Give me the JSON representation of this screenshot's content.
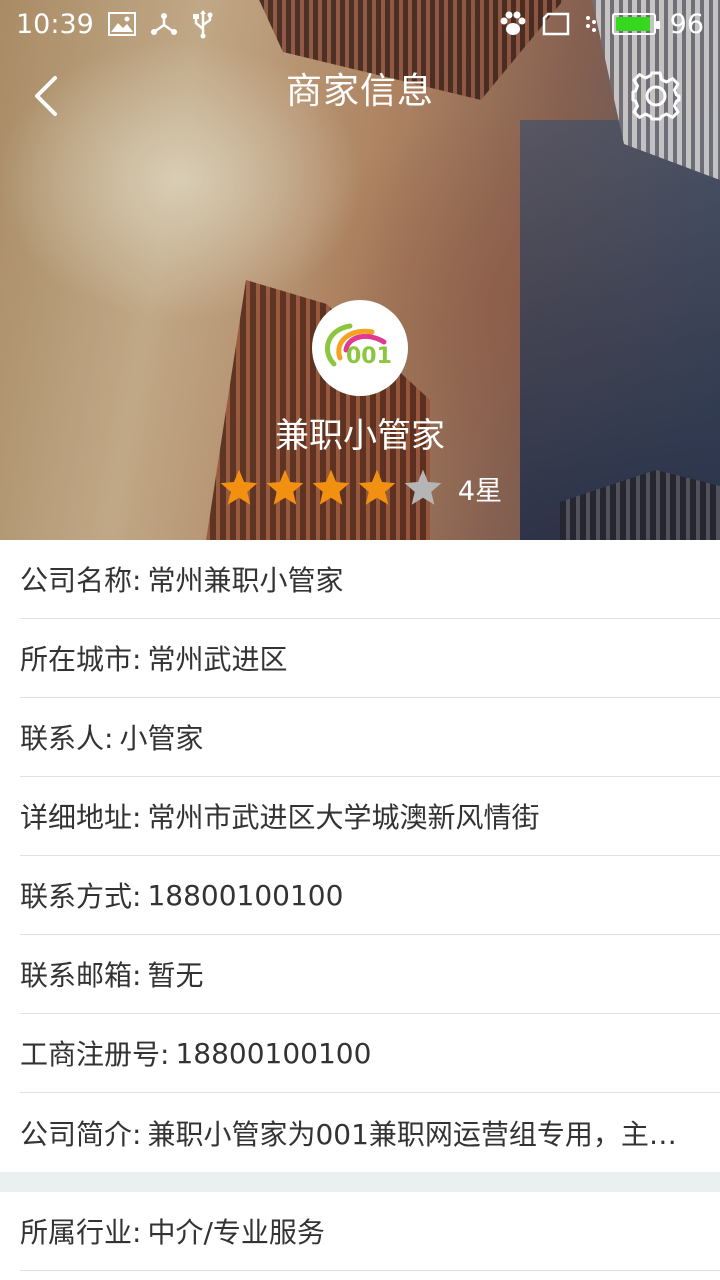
{
  "status_bar": {
    "time": "10:39",
    "battery": "96",
    "battery_level_percent": 96,
    "accent_battery": "#35d81f"
  },
  "header": {
    "title": "商家信息",
    "back_icon": "chevron-left-icon",
    "settings_icon": "gear-icon"
  },
  "profile": {
    "name": "兼职小管家",
    "avatar_logo": "001",
    "rating_stars": 4,
    "rating_max": 5,
    "rating_label": "4星",
    "star_color": "#f29111",
    "star_empty_color": "#b5b5b5"
  },
  "info": [
    {
      "label": "公司名称:",
      "value": "常州兼职小管家"
    },
    {
      "label": "所在城市:",
      "value": "常州武进区"
    },
    {
      "label": "联系人:",
      "value": "小管家"
    },
    {
      "label": "详细地址:",
      "value": "常州市武进区大学城澳新风情街"
    },
    {
      "label": "联系方式:",
      "value": "18800100100"
    },
    {
      "label": "联系邮箱:",
      "value": "暂无"
    },
    {
      "label": "工商注册号:",
      "value": "18800100100"
    },
    {
      "label": "公司简介:",
      "value": "兼职小管家为001兼职网运营组专用，主要.."
    }
  ],
  "extra_info": [
    {
      "label": "所属行业:",
      "value": "中介/专业服务"
    }
  ]
}
